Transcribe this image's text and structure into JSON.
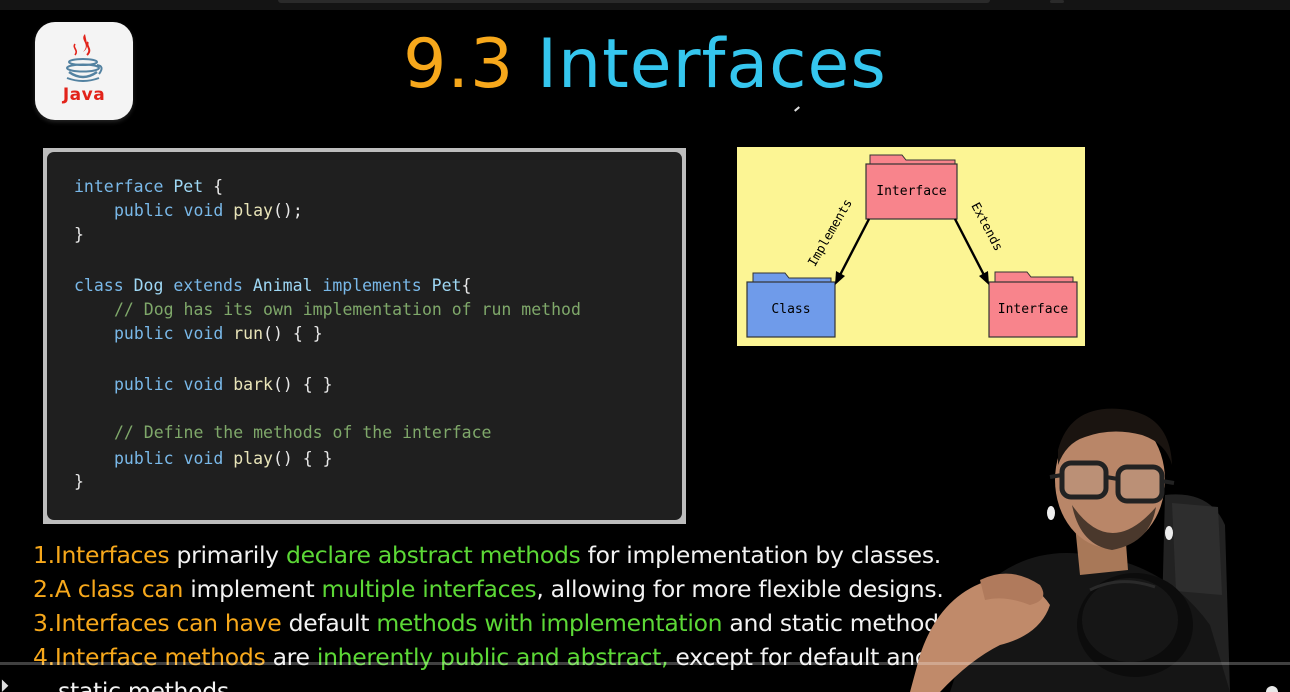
{
  "logo": {
    "text": "Java",
    "icon": "java-coffee-cup-icon",
    "colors": {
      "cup": "#5382a1",
      "steam": "#e2231a"
    }
  },
  "title": {
    "number": "9.3",
    "text": "Interfaces"
  },
  "colors": {
    "orange": "#f7a81b",
    "blue": "#35c6ee",
    "green": "#5cd836",
    "code_bg": "#1f1f1f",
    "diagram_bg": "#fcf594",
    "folder_pink": "#f8848c",
    "folder_blue": "#6f9bea"
  },
  "code": {
    "line1": {
      "kw": "interface",
      "type": "Pet",
      "rest": " {"
    },
    "line2": {
      "kw": "public void",
      "fn": "play",
      "rest": "();"
    },
    "line3": "}",
    "line4": {
      "kw": "class",
      "type1": "Dog",
      "kw2": "extends",
      "type2": "Animal",
      "kw3": "implements",
      "type3": "Pet",
      "rest": "{"
    },
    "line5": "// Dog has its own implementation of run method",
    "line6": {
      "kw": "public void",
      "fn": "run",
      "rest": "() { }"
    },
    "line7": {
      "kw": "public void",
      "fn": "bark",
      "rest": "() { }"
    },
    "line8": "// Define the methods of the interface",
    "line9": {
      "kw": "public void",
      "fn": "play",
      "rest": "() { }"
    },
    "line10": "}"
  },
  "diagram": {
    "top_folder": "Interface",
    "left_folder": "Class",
    "right_folder": "Interface",
    "left_arrow_label": "Implements",
    "right_arrow_label": "Extends"
  },
  "bullets": [
    {
      "num": "1.",
      "parts": [
        {
          "c": "o",
          "t": "Interfaces"
        },
        {
          "c": "w",
          "t": " primarily "
        },
        {
          "c": "g",
          "t": "declare abstract methods"
        },
        {
          "c": "w",
          "t": " for implementation by classes."
        }
      ]
    },
    {
      "num": "2.",
      "parts": [
        {
          "c": "o",
          "t": "A class can"
        },
        {
          "c": "w",
          "t": " implement "
        },
        {
          "c": "g",
          "t": "multiple interfaces"
        },
        {
          "c": "w",
          "t": ", allowing for more flexible designs."
        }
      ]
    },
    {
      "num": "3.",
      "parts": [
        {
          "c": "o",
          "t": "Interfaces can have"
        },
        {
          "c": "w",
          "t": " default "
        },
        {
          "c": "g",
          "t": "methods with implementation"
        },
        {
          "c": "w",
          "t": " and static methods."
        }
      ]
    },
    {
      "num": "4.",
      "parts": [
        {
          "c": "o",
          "t": "Interface methods"
        },
        {
          "c": "w",
          "t": " are "
        },
        {
          "c": "g",
          "t": "inherently public and abstract,"
        },
        {
          "c": "w",
          "t": " except for default and"
        }
      ]
    },
    {
      "num": "",
      "parts": [
        {
          "c": "w",
          "t": "static methods."
        }
      ]
    }
  ],
  "presenter": {
    "icon": "presenter-webcam-feed",
    "microphone_icon": "microphone-icon"
  }
}
